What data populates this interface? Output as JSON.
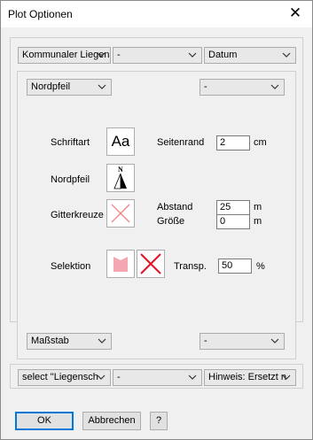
{
  "window": {
    "title": "Plot Optionen",
    "close_glyph": "✕"
  },
  "top_selects": [
    {
      "value": "Kommunaler Liegens"
    },
    {
      "value": "-"
    },
    {
      "value": "Datum"
    }
  ],
  "panel": {
    "nordpfeil_select": "Nordpfeil",
    "right_top_select": "-",
    "schriftart_label": "Schriftart",
    "schriftart_button": "Aa",
    "seitenrand_label": "Seitenrand",
    "seitenrand_value": "2",
    "seitenrand_unit": "cm",
    "nordpfeil_label": "Nordpfeil",
    "nordpfeil_letter": "N",
    "gitterkreuze_label": "Gitterkreuze",
    "abstand_label": "Abstand",
    "abstand_value": "25",
    "abstand_unit": "m",
    "groesse_label": "Größe",
    "groesse_value": "0",
    "groesse_unit": "m",
    "selektion_label": "Selektion",
    "transp_label": "Transp.",
    "transp_value": "50",
    "transp_unit": "%",
    "massstab_select": "Maßstab",
    "right_bottom_select": "-"
  },
  "bottom_selects": [
    {
      "value": "select \"Liegensch"
    },
    {
      "value": "-"
    },
    {
      "value": "Hinweis: Ersetzt n"
    }
  ],
  "buttons": {
    "ok": "OK",
    "cancel": "Abbrechen",
    "help": "?"
  },
  "colors": {
    "selection_fill": "#f4a7b0",
    "cross_red": "#e81123"
  },
  "icons": [
    "close-icon",
    "chevron-down-icon",
    "font-icon",
    "north-arrow-icon",
    "grid-cross-icon",
    "selection-fill-icon",
    "no-fill-icon"
  ]
}
